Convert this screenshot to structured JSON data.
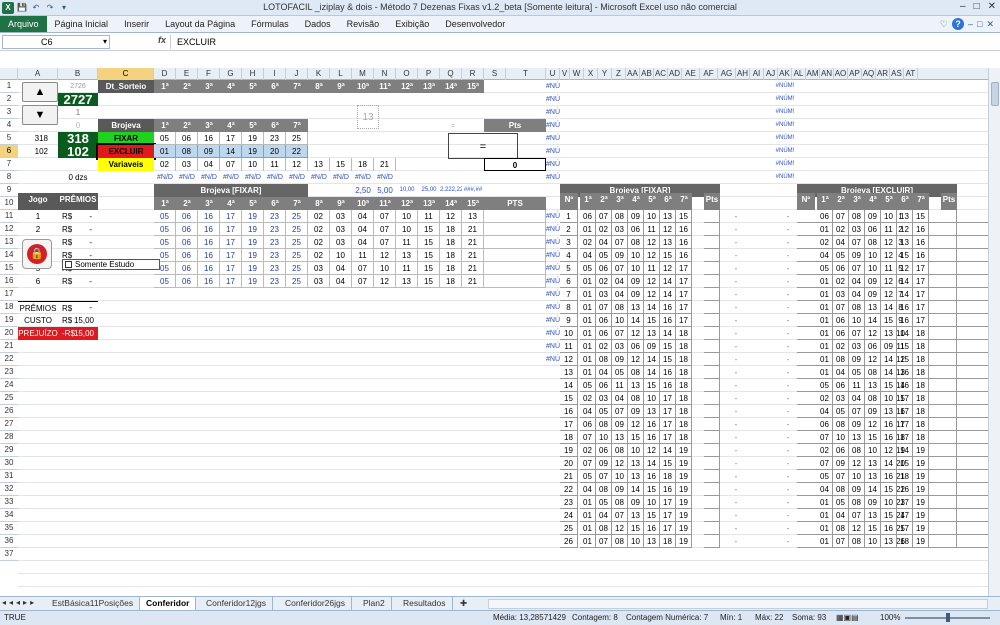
{
  "window": {
    "title": "LOTOFACIL _iziplay & dois - Método 7 Dezenas Fixas v1.2_beta  [Somente leitura]  -  Microsoft Excel uso não comercial",
    "controls": [
      "–",
      "□",
      "✕"
    ]
  },
  "quick_access": [
    "X",
    "💾",
    "↶",
    "↷",
    "▾"
  ],
  "ribbon": {
    "tabs": [
      "Arquivo",
      "Página Inicial",
      "Inserir",
      "Layout da Página",
      "Fórmulas",
      "Dados",
      "Revisão",
      "Exibição",
      "Desenvolvedor"
    ],
    "right_icons": [
      "♡",
      "?",
      "–",
      "□",
      "✕"
    ]
  },
  "formula_bar": {
    "name_box": "C6",
    "fx": "fx",
    "content": "EXCLUIR"
  },
  "columns": [
    "A",
    "B",
    "C",
    "D",
    "E",
    "F",
    "G",
    "H",
    "I",
    "J",
    "K",
    "L",
    "M",
    "N",
    "O",
    "P",
    "Q",
    "R",
    "S",
    "T",
    "U",
    "V",
    "W",
    "X",
    "Y",
    "Z",
    "AA",
    "AB",
    "AC",
    "AD",
    "AE",
    "AF",
    "AG",
    "AH",
    "AI",
    "AJ",
    "AK",
    "AL",
    "AM",
    "AN",
    "AO",
    "AP",
    "AQ",
    "AR",
    "AS",
    "AT"
  ],
  "rows": [
    "1",
    "2",
    "3",
    "4",
    "5",
    "6",
    "7",
    "8",
    "9",
    "10",
    "11",
    "12",
    "13",
    "14",
    "15",
    "16",
    "17",
    "18",
    "19",
    "20",
    "21",
    "22",
    "23",
    "24",
    "25",
    "26",
    "27",
    "28",
    "29",
    "30",
    "31",
    "32",
    "33",
    "34",
    "35",
    "36",
    "37"
  ],
  "left_panel": {
    "contest_prev": "2726",
    "contest_current": "2727",
    "v1": "1",
    "v0": "0",
    "spinner1_value": "318",
    "spinner1_big": "318",
    "spinner2_value": "102",
    "spinner2_big": "102",
    "dzs": "0 dzs",
    "checkbox_label": "Somente Estudo",
    "jogo_header": "Jogo",
    "premios_header": "PRÊMIOS",
    "jogos": [
      "1",
      "2",
      "3",
      "4",
      "5",
      "6"
    ],
    "rs": "R$",
    "dash": "-",
    "premios_label": "PRÊMIOS",
    "custo_label": "CUSTO",
    "custo_value": "15,00",
    "prejuizo_label": "PREJUÍZO",
    "prejuizo_rs": "-R$",
    "prejuizo_value": "15,00"
  },
  "top_table": {
    "dt_sorteio": "Dt_Sorteio",
    "headers": [
      "1ª",
      "2ª",
      "3ª",
      "4ª",
      "5ª",
      "6ª",
      "7ª",
      "8ª",
      "9ª",
      "10ª",
      "11ª",
      "12ª",
      "13ª",
      "14ª",
      "15ª"
    ],
    "brojeva": "Brojeva",
    "brojeva_headers": [
      "1ª",
      "2ª",
      "3ª",
      "4ª",
      "5ª",
      "6ª",
      "7ª"
    ],
    "fixar_label": "FIXAR",
    "fixar": [
      "05",
      "06",
      "16",
      "17",
      "19",
      "23",
      "25"
    ],
    "excluir_label": "EXCLUIR",
    "excluir": [
      "01",
      "08",
      "09",
      "14",
      "19",
      "20",
      "22"
    ],
    "variaveis_label": "Variaveis",
    "variaveis": [
      "02",
      "03",
      "04",
      "07",
      "10",
      "11",
      "12",
      "13",
      "15",
      "18",
      "21"
    ],
    "na_row": [
      "#N/D",
      "#N/D",
      "#N/D",
      "#N/D",
      "#N/D",
      "#N/D",
      "#N/D",
      "#N/D",
      "#N/D",
      "#N/D",
      "#N/D"
    ],
    "box13": "13",
    "eq1": "=",
    "eq2": "=",
    "pts_label": "Pts",
    "pts_value": "0",
    "scale_row": [
      "2,50",
      "5,00",
      "10,00",
      "25,00",
      "2.222,22",
      "###,##"
    ]
  },
  "games_table": {
    "title": "Brojeva [FIXAR]",
    "headers": [
      "1ª",
      "2ª",
      "3ª",
      "4ª",
      "5ª",
      "6ª",
      "7ª",
      "8ª",
      "9ª",
      "10ª",
      "11ª",
      "12ª",
      "13ª",
      "14ª",
      "15ª"
    ],
    "pts_header": "PTS",
    "rows": [
      [
        "05",
        "06",
        "16",
        "17",
        "19",
        "23",
        "25",
        "02",
        "03",
        "04",
        "07",
        "10",
        "11",
        "12",
        "13"
      ],
      [
        "05",
        "06",
        "16",
        "17",
        "19",
        "23",
        "25",
        "02",
        "03",
        "04",
        "07",
        "10",
        "15",
        "18",
        "21"
      ],
      [
        "05",
        "06",
        "16",
        "17",
        "19",
        "23",
        "25",
        "02",
        "03",
        "04",
        "07",
        "11",
        "15",
        "18",
        "21"
      ],
      [
        "05",
        "06",
        "16",
        "17",
        "19",
        "23",
        "25",
        "02",
        "10",
        "11",
        "12",
        "13",
        "15",
        "18",
        "21"
      ],
      [
        "05",
        "06",
        "16",
        "17",
        "19",
        "23",
        "25",
        "03",
        "04",
        "07",
        "10",
        "11",
        "15",
        "18",
        "21"
      ],
      [
        "05",
        "06",
        "16",
        "17",
        "19",
        "23",
        "25",
        "03",
        "04",
        "07",
        "12",
        "13",
        "15",
        "18",
        "21"
      ]
    ]
  },
  "num_errors": "#NÚM!",
  "fixar_panel": {
    "title": "Brojeva [FIXAR]",
    "no": "Nº",
    "headers": [
      "1ª",
      "2ª",
      "3ª",
      "4ª",
      "5ª",
      "6ª",
      "7ª"
    ],
    "pts": "Pts",
    "rows": [
      [
        "1",
        "06",
        "07",
        "08",
        "09",
        "10",
        "13",
        "15"
      ],
      [
        "2",
        "01",
        "02",
        "03",
        "06",
        "11",
        "12",
        "16"
      ],
      [
        "3",
        "02",
        "04",
        "07",
        "08",
        "12",
        "13",
        "16"
      ],
      [
        "4",
        "04",
        "05",
        "09",
        "10",
        "12",
        "15",
        "16"
      ],
      [
        "5",
        "05",
        "06",
        "07",
        "10",
        "11",
        "12",
        "17"
      ],
      [
        "6",
        "01",
        "02",
        "04",
        "09",
        "12",
        "14",
        "17"
      ],
      [
        "7",
        "01",
        "03",
        "04",
        "09",
        "12",
        "14",
        "17"
      ],
      [
        "8",
        "01",
        "07",
        "08",
        "13",
        "14",
        "16",
        "17"
      ],
      [
        "9",
        "01",
        "06",
        "10",
        "14",
        "15",
        "16",
        "17"
      ],
      [
        "10",
        "01",
        "06",
        "07",
        "12",
        "13",
        "14",
        "18"
      ],
      [
        "11",
        "01",
        "02",
        "03",
        "06",
        "09",
        "15",
        "18"
      ],
      [
        "12",
        "01",
        "08",
        "09",
        "12",
        "14",
        "15",
        "18"
      ],
      [
        "13",
        "01",
        "04",
        "05",
        "08",
        "14",
        "16",
        "18"
      ],
      [
        "14",
        "05",
        "06",
        "11",
        "13",
        "15",
        "16",
        "18"
      ],
      [
        "15",
        "02",
        "03",
        "04",
        "08",
        "10",
        "17",
        "18"
      ],
      [
        "16",
        "04",
        "05",
        "07",
        "09",
        "13",
        "17",
        "18"
      ],
      [
        "17",
        "06",
        "08",
        "09",
        "12",
        "16",
        "17",
        "18"
      ],
      [
        "18",
        "07",
        "10",
        "13",
        "15",
        "16",
        "17",
        "18"
      ],
      [
        "19",
        "02",
        "06",
        "08",
        "10",
        "12",
        "14",
        "19"
      ],
      [
        "20",
        "07",
        "09",
        "12",
        "13",
        "14",
        "15",
        "19"
      ],
      [
        "21",
        "05",
        "07",
        "10",
        "13",
        "16",
        "18",
        "19"
      ],
      [
        "22",
        "04",
        "08",
        "09",
        "14",
        "15",
        "16",
        "19"
      ],
      [
        "23",
        "01",
        "05",
        "08",
        "09",
        "10",
        "17",
        "19"
      ],
      [
        "24",
        "01",
        "04",
        "07",
        "13",
        "15",
        "17",
        "19"
      ],
      [
        "25",
        "01",
        "08",
        "12",
        "15",
        "16",
        "17",
        "19"
      ],
      [
        "26",
        "01",
        "07",
        "08",
        "10",
        "13",
        "18",
        "19"
      ]
    ]
  },
  "excluir_panel": {
    "title": "Brojeva [EXCLUIR]",
    "no": "Nº",
    "headers": [
      "1ª",
      "2ª",
      "3ª",
      "4ª",
      "5ª",
      "6ª",
      "7ª"
    ],
    "pts": "Pts"
  },
  "sheet_tabs": [
    "EstBásica11Posições",
    "Conferidor",
    "Conferidor12jgs",
    "Conferidor26jgs",
    "Plan2",
    "Resultados"
  ],
  "active_sheet": "Conferidor",
  "status": {
    "mode": "TRUE",
    "media": "Média: 13,28571429",
    "contagem": "Contagem: 8",
    "contagem_num": "Contagem Numérica: 7",
    "min": "Mín: 1",
    "max": "Máx: 22",
    "soma": "Soma: 93",
    "zoom": "100%"
  },
  "colors": {
    "accent": "#1f7246",
    "fixar_bg": "#1fd21f",
    "excluir_bg": "#e0191e",
    "variaveis_bg": "#ffff00",
    "contest_bg": "#0a5c1e",
    "selection": "#f3d280"
  }
}
